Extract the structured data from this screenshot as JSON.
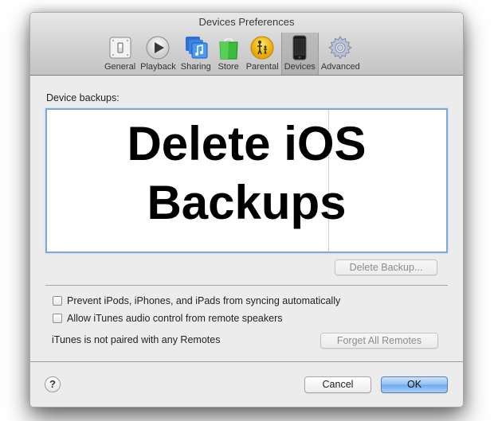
{
  "window": {
    "title": "Devices Preferences"
  },
  "toolbar": {
    "tabs": [
      {
        "label": "General",
        "icon": "general-switch-icon",
        "selected": false
      },
      {
        "label": "Playback",
        "icon": "play-icon",
        "selected": false
      },
      {
        "label": "Sharing",
        "icon": "sharing-music-icon",
        "selected": false
      },
      {
        "label": "Store",
        "icon": "shopping-bag-icon",
        "selected": false
      },
      {
        "label": "Parental",
        "icon": "parental-family-icon",
        "selected": false
      },
      {
        "label": "Devices",
        "icon": "iphone-icon",
        "selected": true
      },
      {
        "label": "Advanced",
        "icon": "gear-icon",
        "selected": false
      }
    ]
  },
  "backups": {
    "label": "Device backups:",
    "overlay_line1": "Delete iOS",
    "overlay_line2": "Backups",
    "delete_button": "Delete Backup..."
  },
  "options": {
    "prevent_sync": {
      "label": "Prevent iPods, iPhones, and iPads from syncing automatically",
      "checked": false
    },
    "allow_remote_audio": {
      "label": "Allow iTunes audio control from remote speakers",
      "checked": false
    },
    "remotes_status": "iTunes is not paired with any Remotes",
    "forget_remotes_button": "Forget All Remotes"
  },
  "footer": {
    "help": "?",
    "cancel": "Cancel",
    "ok": "OK"
  },
  "colors": {
    "accent": "#7fa9d9",
    "default_button": "#8ebef2"
  }
}
